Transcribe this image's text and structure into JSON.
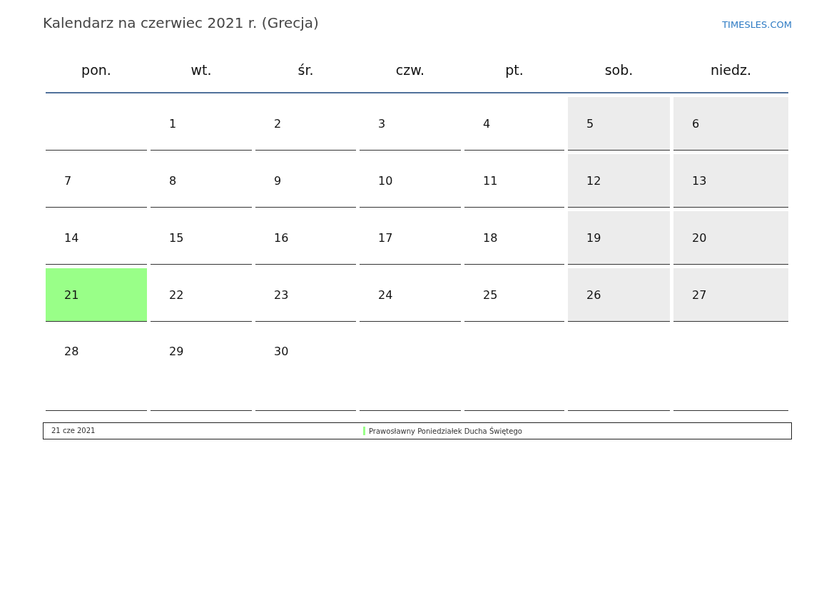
{
  "title": "Kalendarz na czerwiec 2021 r. (Grecja)",
  "site_link": "TIMESLES.COM",
  "weekdays": [
    "pon.",
    "wt.",
    "śr.",
    "czw.",
    "pt.",
    "sob.",
    "niedz."
  ],
  "weeks": [
    [
      {
        "weekend": false
      },
      {
        "day": "1",
        "weekend": false
      },
      {
        "day": "2",
        "weekend": false
      },
      {
        "day": "3",
        "weekend": false
      },
      {
        "day": "4",
        "weekend": false
      },
      {
        "day": "5",
        "weekend": true
      },
      {
        "day": "6",
        "weekend": true
      }
    ],
    [
      {
        "day": "7",
        "weekend": false
      },
      {
        "day": "8",
        "weekend": false
      },
      {
        "day": "9",
        "weekend": false
      },
      {
        "day": "10",
        "weekend": false
      },
      {
        "day": "11",
        "weekend": false
      },
      {
        "day": "12",
        "weekend": true
      },
      {
        "day": "13",
        "weekend": true
      }
    ],
    [
      {
        "day": "14",
        "weekend": false
      },
      {
        "day": "15",
        "weekend": false
      },
      {
        "day": "16",
        "weekend": false
      },
      {
        "day": "17",
        "weekend": false
      },
      {
        "day": "18",
        "weekend": false
      },
      {
        "day": "19",
        "weekend": true
      },
      {
        "day": "20",
        "weekend": true
      }
    ],
    [
      {
        "day": "21",
        "color": "#99ff88"
      },
      {
        "day": "22",
        "weekend": false
      },
      {
        "day": "23",
        "weekend": false
      },
      {
        "day": "24",
        "weekend": false
      },
      {
        "day": "25",
        "weekend": false
      },
      {
        "day": "26",
        "weekend": true
      },
      {
        "day": "27",
        "weekend": true
      }
    ],
    [
      {
        "day": "28",
        "weekend": false
      },
      {
        "day": "29",
        "weekend": false
      },
      {
        "day": "30",
        "weekend": false
      },
      {
        "weekend": false
      },
      {
        "weekend": false
      },
      {
        "weekend": false
      },
      {
        "weekend": false
      }
    ]
  ],
  "holidays": [
    {
      "date": "21 cze 2021",
      "name": "Prawosławny Poniedziałek Ducha Świętego",
      "color": "#99ff88"
    }
  ]
}
